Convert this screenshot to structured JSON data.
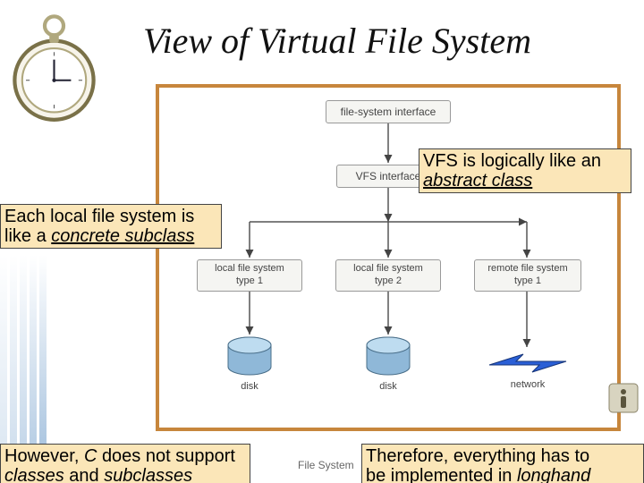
{
  "title": "View of Virtual File System",
  "diagram": {
    "top": "file-system interface",
    "mid": "VFS interface",
    "fs1": "local file system\ntype 1",
    "fs2": "local file system\ntype 2",
    "fs3": "remote file system\ntype 1",
    "disk_label": "disk",
    "network_label": "network"
  },
  "callouts": {
    "vfs_line1": "VFS is logically like an",
    "vfs_u": "abstract class",
    "each_line1": "Each local file system is",
    "each_line2a": "like a ",
    "each_u": "concrete subclass",
    "c_line1a": "However, ",
    "c_i1": "C ",
    "c_line1b": "does not support",
    "c_i2": "classes",
    "c_line2a": " and ",
    "c_i3": "subclasses",
    "long_line1": "Therefore, everything has to",
    "long_line2a": "be implemented in ",
    "long_i": "longhand"
  },
  "footer": "File System",
  "icons": {
    "watch": "pocket-watch-icon",
    "info": "info-icon",
    "disk": "disk-icon",
    "network": "network-icon",
    "arrow": "arrow-icon"
  }
}
